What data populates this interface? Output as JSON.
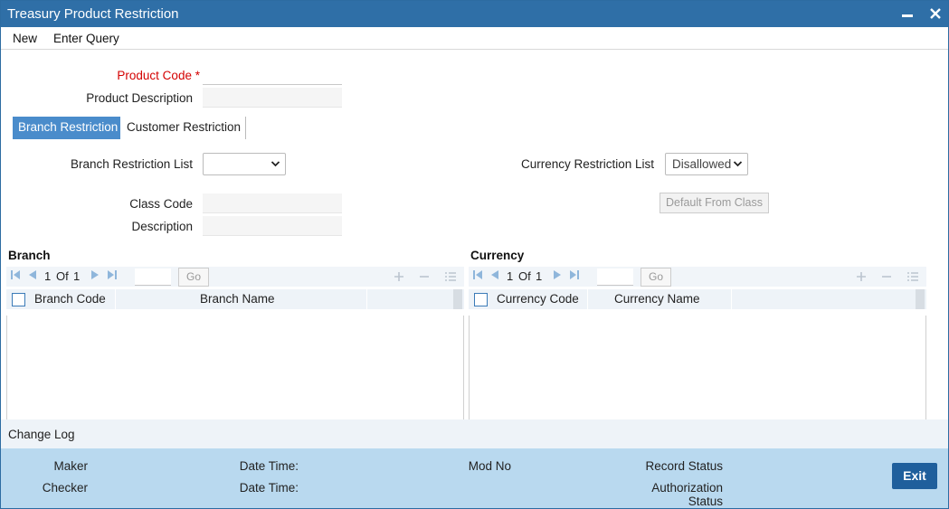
{
  "window": {
    "title": "Treasury Product Restriction",
    "minimize_glyph": "▬",
    "close_glyph": "✕"
  },
  "menu": {
    "new_label": "New",
    "enter_query_label": "Enter Query"
  },
  "form": {
    "product_code_label": "Product Code",
    "required_marker": "*",
    "product_code_value": "",
    "product_description_label": "Product Description",
    "product_description_value": ""
  },
  "tabs": {
    "branch_restriction": "Branch Restriction",
    "customer_restriction": "Customer Restriction",
    "active": "branch_restriction"
  },
  "restrictions": {
    "branch_list_label": "Branch Restriction List",
    "branch_list_value": "",
    "currency_list_label": "Currency Restriction List",
    "currency_list_value": "Disallowed",
    "class_code_label": "Class Code",
    "class_code_value": "",
    "description_label": "Description",
    "description_value": "",
    "default_from_class_label": "Default From Class"
  },
  "branch_grid": {
    "title": "Branch",
    "page_current": "1",
    "page_of": "Of",
    "page_total": "1",
    "go_label": "Go",
    "columns": [
      "Branch Code",
      "Branch Name"
    ],
    "rows": []
  },
  "currency_grid": {
    "title": "Currency",
    "page_current": "1",
    "page_of": "Of",
    "page_total": "1",
    "go_label": "Go",
    "columns": [
      "Currency Code",
      "Currency Name"
    ],
    "rows": []
  },
  "icons": {
    "first_page": "first-page-icon",
    "prev_page": "prev-page-icon",
    "next_page": "next-page-icon",
    "last_page": "last-page-icon",
    "add_row": "plus-icon",
    "delete_row": "minus-icon",
    "single_view": "list-view-icon",
    "dropdown": "chevron-down-icon"
  },
  "change_log": {
    "title": "Change Log"
  },
  "footer": {
    "maker_label": "Maker",
    "checker_label": "Checker",
    "date_time_label_1": "Date Time:",
    "date_time_label_2": "Date Time:",
    "mod_no_label": "Mod No",
    "record_status_label": "Record Status",
    "authorization_status_label_1": "Authorization",
    "authorization_status_label_2": "Status",
    "exit_label": "Exit"
  },
  "colors": {
    "title_bar": "#2f6fa7",
    "active_tab": "#4a8ccb",
    "footer_bg": "#b9d9ef",
    "exit_button": "#1f5f9c",
    "required": "#d40000"
  }
}
